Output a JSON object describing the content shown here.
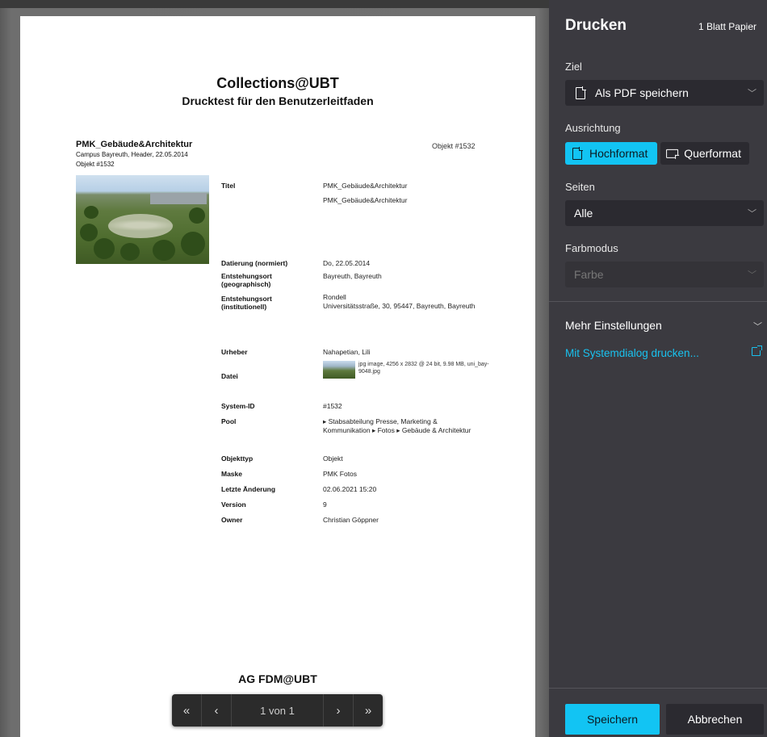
{
  "document": {
    "title": "Collections@UBT",
    "subtitle": "Drucktest für den Benutzerleitfaden",
    "object_name": "PMK_Gebäude&Architektur",
    "object_sub1": "Campus Bayreuth, Header, 22.05.2014",
    "object_sub2": "Objekt #1532",
    "object_number": "Objekt #1532",
    "fields": [
      {
        "label": "Titel",
        "value": "PMK_Gebäude&Architektur"
      },
      {
        "label": "",
        "value": "PMK_Gebäude&Architektur"
      },
      {
        "label": "Datierung (normiert)",
        "value": "Do, 22.05.2014"
      },
      {
        "label": "Entstehungsort (geographisch)",
        "value": "Bayreuth, Bayreuth"
      },
      {
        "label": "Entstehungsort (institutionell)",
        "value": "Rondell\nUniversitätsstraße, 30, 95447, Bayreuth, Bayreuth"
      },
      {
        "label": "Urheber",
        "value": "Nahapetian, Lili"
      },
      {
        "label": "Datei",
        "value": ""
      },
      {
        "label": "System-ID",
        "value": "#1532"
      },
      {
        "label": "Pool",
        "value": "▸ Stabsabteilung Presse, Marketing & Kommunikation ▸ Fotos ▸ Gebäude & Architektur"
      },
      {
        "label": "Objekttyp",
        "value": "Objekt"
      },
      {
        "label": "Maske",
        "value": "PMK Fotos"
      },
      {
        "label": "Letzte Änderung",
        "value": "02.06.2021 15:20"
      },
      {
        "label": "Version",
        "value": "9"
      },
      {
        "label": "Owner",
        "value": "Christian Göppner"
      }
    ],
    "file_info": "jpg image, 4256 x 2832 @ 24 bit, 9.98 MB, uni_bay-9048.jpg",
    "footer": "AG FDM@UBT"
  },
  "pager": {
    "first": "«",
    "prev": "‹",
    "info": "1 von 1",
    "next": "›",
    "last": "»"
  },
  "sidebar": {
    "title": "Drucken",
    "sheets": "1 Blatt Papier",
    "destination_label": "Ziel",
    "destination_value": "Als PDF speichern",
    "orientation_label": "Ausrichtung",
    "orientation_portrait": "Hochformat",
    "orientation_landscape": "Querformat",
    "pages_label": "Seiten",
    "pages_value": "Alle",
    "color_label": "Farbmodus",
    "color_value": "Farbe",
    "more_settings": "Mehr Einstellungen",
    "system_dialog": "Mit Systemdialog drucken...",
    "save": "Speichern",
    "cancel": "Abbrechen"
  },
  "colors": {
    "accent": "#12c4f3",
    "sidebar_bg": "#3b3a40",
    "control_bg": "#2b2a30"
  }
}
